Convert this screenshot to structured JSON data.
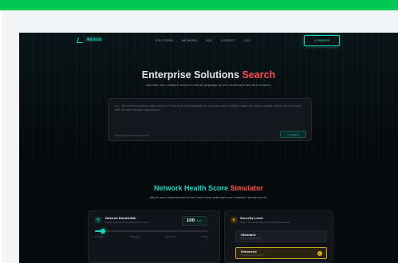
{
  "colors": {
    "accent": "#1dd3c1",
    "highlight": "#ff4d4f",
    "gold": "#e0b31c",
    "background": "#07090c",
    "browser_bar": "#00c853"
  },
  "nav": {
    "logo_text": "NEXUS",
    "links": [
      "SOLUTIONS",
      "NETWORK",
      "ESG",
      "CONTACT"
    ],
    "lang": "| 中 |",
    "cta": "◎ MEMBER"
  },
  "hero": {
    "title_main": "Enterprise Solutions",
    "title_accent": "Search",
    "subtitle": "Describe your network needs in natural language. AI will recommend the best solution.",
    "search_placeholder": "e.g., We need to connect data centers in Frankfurt and Shanghai for real-time stock trading, requiring latency below xxxms, must comply with EU and CN data regulations...",
    "search_hint": "Press ⌘ Enter to start search",
    "search_button": "→ Analyze"
  },
  "simulator": {
    "title_main": "Network Health Score",
    "title_accent": "Simulator",
    "subtitle": "Adjust your requirements to see how these optimizes your network infrastructure.",
    "bandwidth": {
      "icon": "bandwidth-icon",
      "title": "Desired Bandwidth",
      "subtitle": "Higher bandwidth enables more nodes",
      "value": "100",
      "unit": "Gbps",
      "level": 0.07,
      "ticks": [
        "10 Gbps",
        "500 Gbps",
        "300 Gbps",
        "1 Tbps"
      ]
    },
    "security": {
      "icon": "shield-icon",
      "title": "Security Level",
      "subtitle": "Higher security ensures more DDS measures",
      "options": [
        {
          "name": "Standard",
          "desc": "TLS 1.x, Basic ACLs",
          "selected": false
        },
        {
          "name": "Enhanced",
          "desc": "Post-Quantum Crypto",
          "selected": true
        }
      ]
    }
  }
}
